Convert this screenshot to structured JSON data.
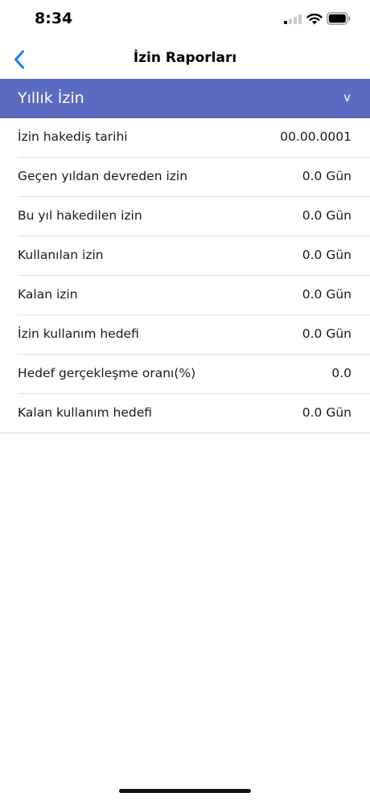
{
  "status_bar": {
    "time": "8:34"
  },
  "nav": {
    "title": "İzin Raporları",
    "back_icon": "chevron-left-icon"
  },
  "section": {
    "title": "Yıllık İzin",
    "chevron": "v"
  },
  "rows": [
    {
      "label": "İzin hakediş tarihi",
      "value": "00.00.0001"
    },
    {
      "label": "Geçen yıldan devreden izin",
      "value": "0.0 Gün"
    },
    {
      "label": "Bu yıl hakedilen izin",
      "value": "0.0 Gün"
    },
    {
      "label": "Kullanılan izin",
      "value": "0.0 Gün"
    },
    {
      "label": "Kalan izin",
      "value": "0.0 Gün"
    },
    {
      "label": "İzin kullanım hedefi",
      "value": "0.0 Gün"
    },
    {
      "label": "Hedef gerçekleşme oranı(%)",
      "value": "0.0"
    },
    {
      "label": "Kalan kullanım hedefi",
      "value": "0.0 Gün"
    }
  ],
  "colors": {
    "accent": "#5b6bc1",
    "link": "#1a7cf0"
  }
}
